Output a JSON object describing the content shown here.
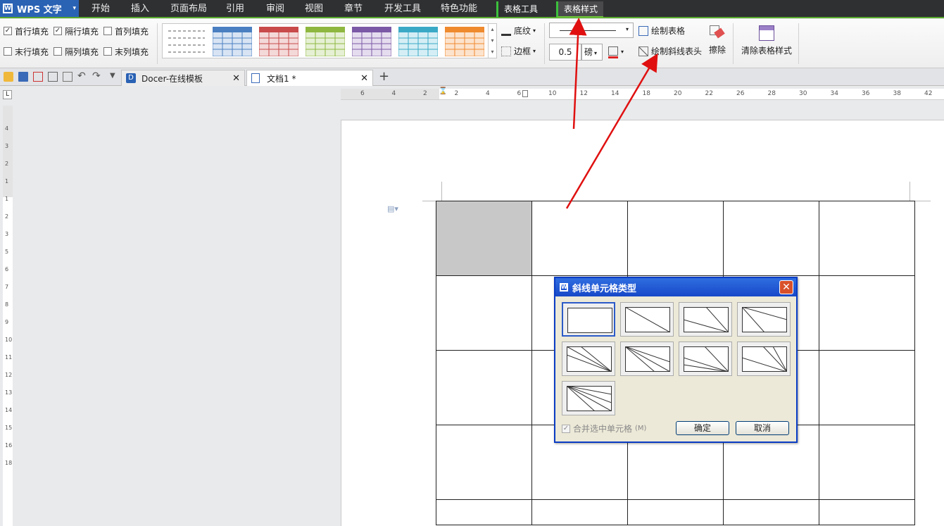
{
  "app": {
    "name": "WPS 文字"
  },
  "menu": {
    "items": [
      "开始",
      "插入",
      "页面布局",
      "引用",
      "审阅",
      "视图",
      "章节",
      "开发工具",
      "特色功能"
    ],
    "ctx_tabs": [
      "表格工具",
      "表格样式"
    ]
  },
  "ribbon": {
    "checks": [
      {
        "label": "首行填充",
        "checked": "✓"
      },
      {
        "label": "隔行填充",
        "checked": "✓"
      },
      {
        "label": "首列填充",
        "checked": ""
      },
      {
        "label": "末行填充",
        "checked": ""
      },
      {
        "label": "隔列填充",
        "checked": ""
      },
      {
        "label": "末列填充",
        "checked": ""
      }
    ],
    "shading": "底纹",
    "border": "边框",
    "line_width": "0.5",
    "unit": "磅",
    "draw_table": "绘制表格",
    "draw_diagonal": "绘制斜线表头",
    "erase": "擦除",
    "clear_style": "清除表格样式",
    "style_colors": [
      "#ffffff",
      "#4a7fc1",
      "#c94a4a",
      "#8db73f",
      "#7b59a6",
      "#3aa9c6",
      "#ef8a2e"
    ]
  },
  "tabs": [
    {
      "label": "Docer-在线模板"
    },
    {
      "label": "文档1 *"
    }
  ],
  "ruler": {
    "h": [
      "6",
      "4",
      "2",
      "2",
      "4",
      "6",
      "10",
      "12",
      "14",
      "18",
      "20",
      "22",
      "26",
      "28",
      "30",
      "34",
      "36",
      "38",
      "42"
    ],
    "v": [
      "4",
      "3",
      "2",
      "1",
      "1",
      "2",
      "3",
      "5",
      "6",
      "7",
      "8",
      "9",
      "10",
      "11",
      "12",
      "13",
      "14",
      "15",
      "16",
      "18"
    ]
  },
  "dialog": {
    "title": "斜线单元格类型",
    "merge_label": "合并选中单元格",
    "merge_key": "(M)",
    "ok": "确定",
    "cancel": "取消"
  }
}
